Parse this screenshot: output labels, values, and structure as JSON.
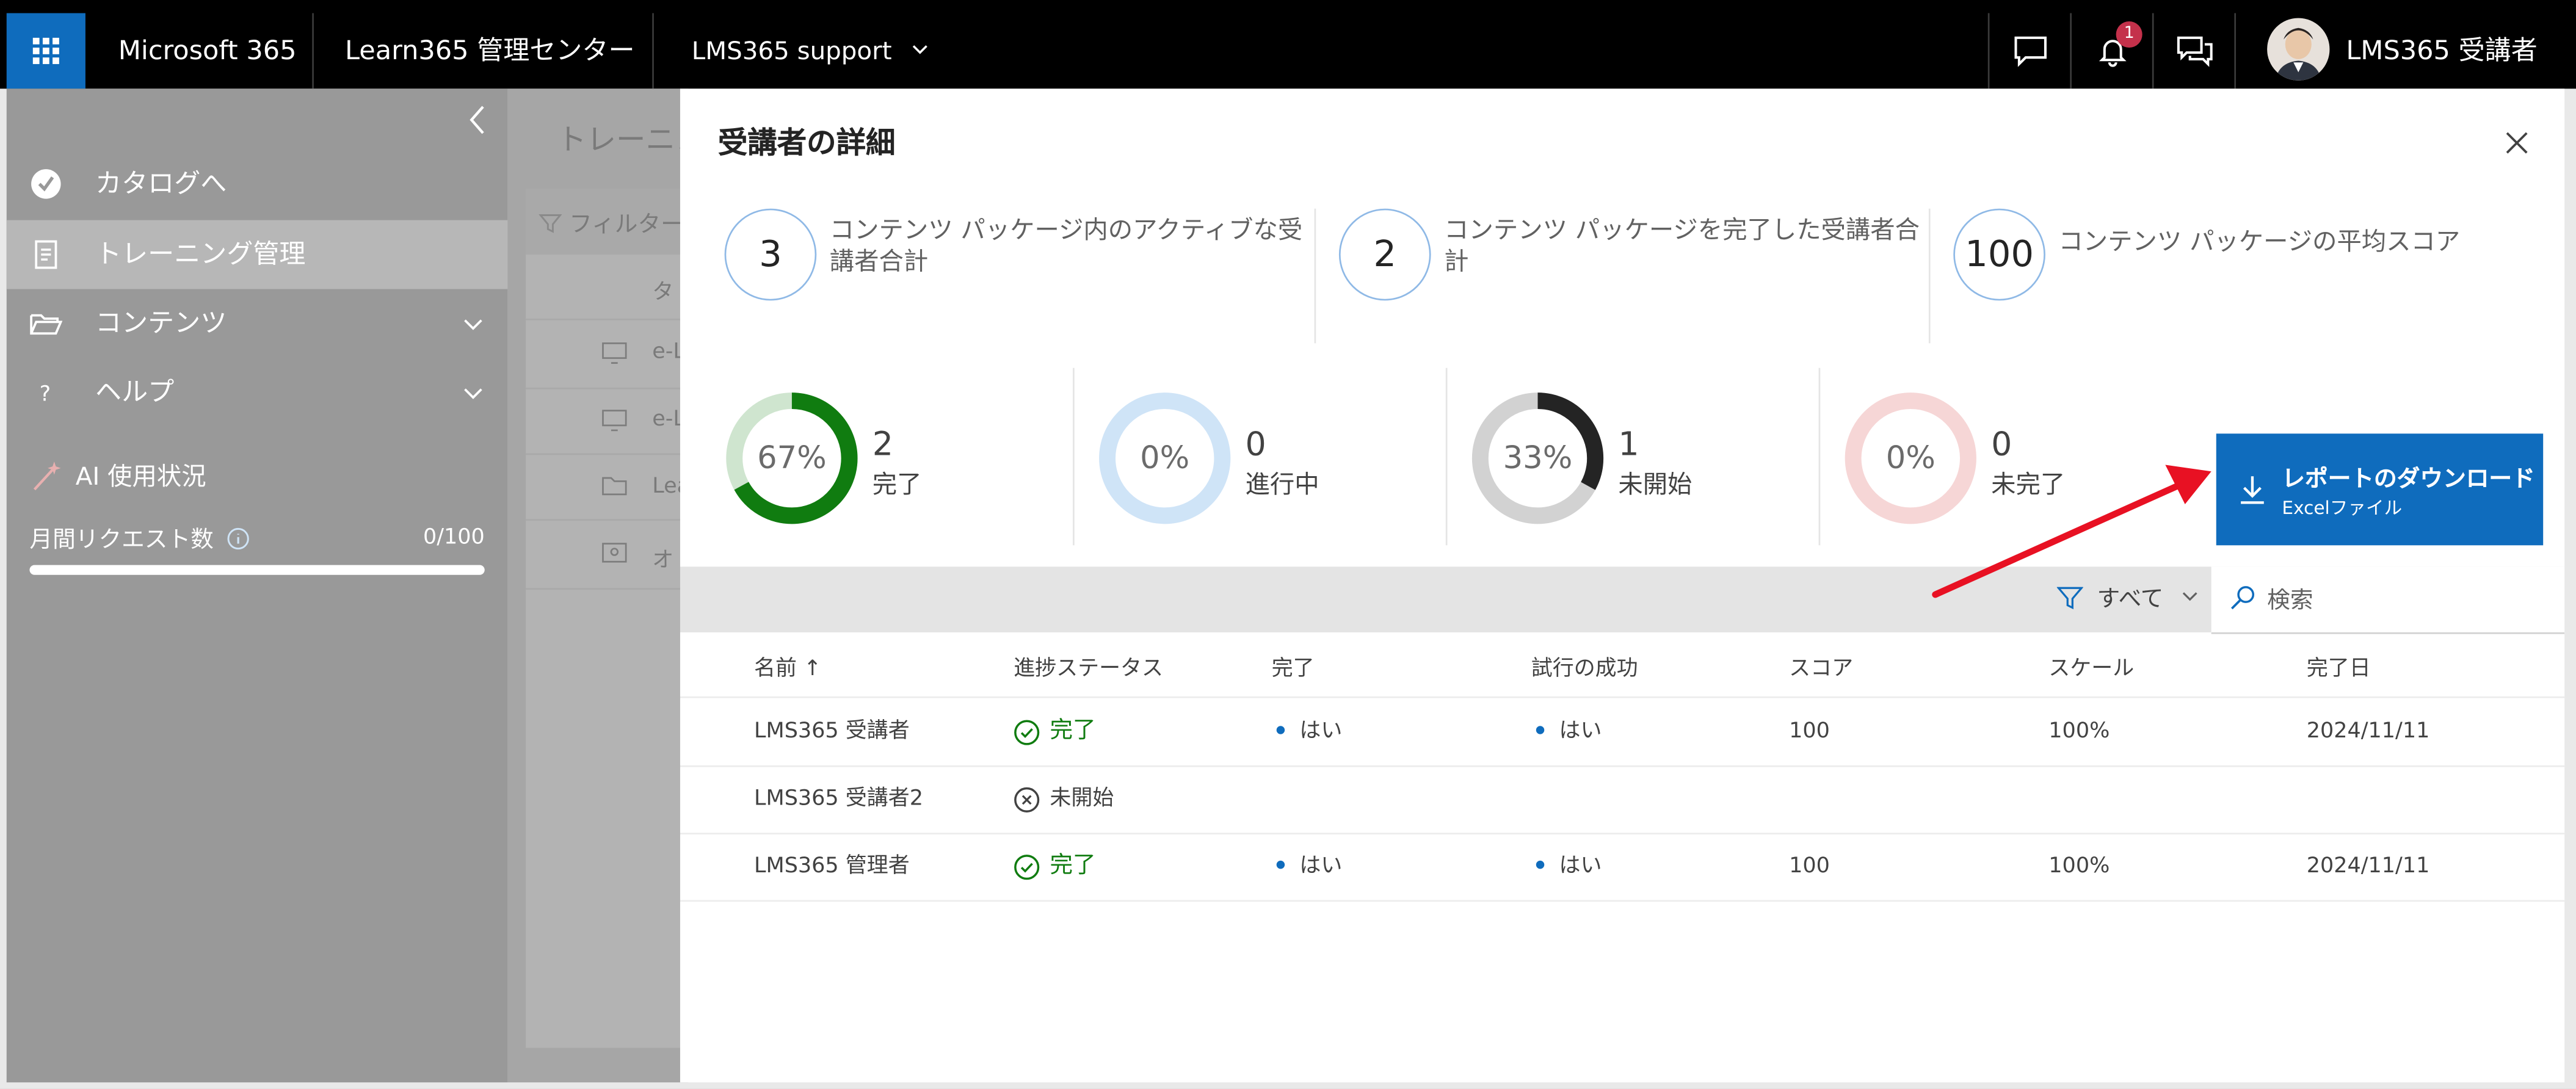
{
  "topbar": {
    "app_name": "Microsoft 365",
    "admin_center": "Learn365 管理センター",
    "tenant": "LMS365 support",
    "notification_count": "1",
    "user_name": "LMS365 受講者"
  },
  "sidebar": {
    "items": [
      {
        "label": "カタログへ"
      },
      {
        "label": "トレーニング管理"
      },
      {
        "label": "コンテンツ"
      },
      {
        "label": "ヘルプ"
      }
    ],
    "ai_label": "AI 使用状況",
    "monthly_label": "月間リクエスト数",
    "monthly_count": "0/100"
  },
  "background": {
    "title_fragment": "トレーニン",
    "filter_fragment": "フィルター",
    "header_fragment": "タ",
    "rows": [
      "e-L",
      "e-L",
      "Lea",
      "オ"
    ]
  },
  "panel": {
    "title": "受講者の詳細",
    "stats": [
      {
        "value": "3",
        "label": "コンテンツ パッケージ内のアクティブな受講者合計"
      },
      {
        "value": "2",
        "label": "コンテンツ パッケージを完了した受講者合計"
      },
      {
        "value": "100",
        "label": "コンテンツ パッケージの平均スコア"
      }
    ],
    "progress": [
      {
        "pct": "67%",
        "count": "2",
        "label": "完了",
        "fraction": 0.67,
        "color": "#107c10",
        "track": "#cfe5cf"
      },
      {
        "pct": "0%",
        "count": "0",
        "label": "進行中",
        "fraction": 0,
        "color": "#0f6cbd",
        "track": "#cfe4f7"
      },
      {
        "pct": "33%",
        "count": "1",
        "label": "未開始",
        "fraction": 0.33,
        "color": "#242424",
        "track": "#d2d2d2"
      },
      {
        "pct": "0%",
        "count": "0",
        "label": "未完了",
        "fraction": 0,
        "color": "#c4314b",
        "track": "#f6d6d6"
      }
    ],
    "download": {
      "title": "レポートのダウンロード",
      "subtitle": "Excelファイル"
    },
    "filter_label": "すべて",
    "search_placeholder": "検索",
    "columns": [
      "名前 ↑",
      "進捗ステータス",
      "完了",
      "試行の成功",
      "スコア",
      "スケール",
      "完了日"
    ],
    "rows": [
      {
        "name": "LMS365 受講者",
        "status": "完了",
        "done": true,
        "completed": "はい",
        "success": "はい",
        "score": "100",
        "scale": "100%",
        "date": "2024/11/11"
      },
      {
        "name": "LMS365 受講者2",
        "status": "未開始",
        "done": false,
        "completed": "",
        "success": "",
        "score": "",
        "scale": "",
        "date": ""
      },
      {
        "name": "LMS365 管理者",
        "status": "完了",
        "done": true,
        "completed": "はい",
        "success": "はい",
        "score": "100",
        "scale": "100%",
        "date": "2024/11/11"
      }
    ]
  },
  "colors": {
    "accent": "#0f6cbd",
    "success": "#107c10",
    "annotation_arrow": "#e81123"
  }
}
